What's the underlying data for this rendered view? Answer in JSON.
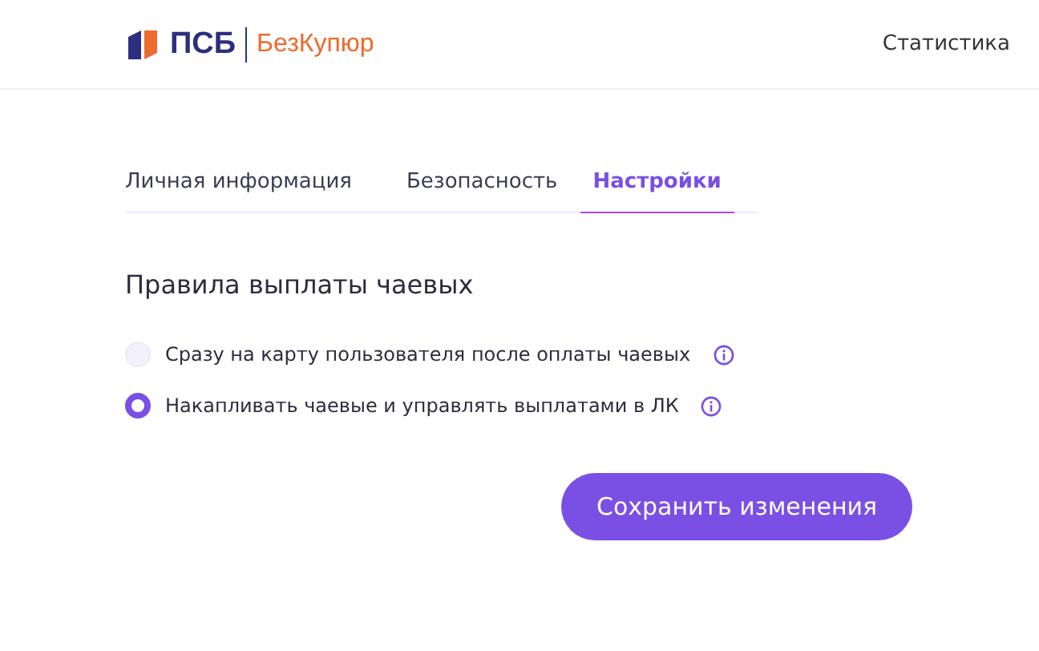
{
  "header": {
    "logo_main": "ПСБ",
    "logo_sub": "БезКупюр",
    "nav_link": "Статистика"
  },
  "tabs": [
    {
      "label": "Личная информация",
      "selected": false
    },
    {
      "label": "Безопасность",
      "selected": false
    },
    {
      "label": "Настройки",
      "selected": true
    }
  ],
  "section_title": "Правила выплаты чаевых",
  "options": [
    {
      "label": "Сразу на карту пользователя после оплаты чаевых",
      "selected": false
    },
    {
      "label": "Накапливать чаевые и управлять выплатами в ЛК",
      "selected": true
    }
  ],
  "save_button": "Сохранить изменения"
}
